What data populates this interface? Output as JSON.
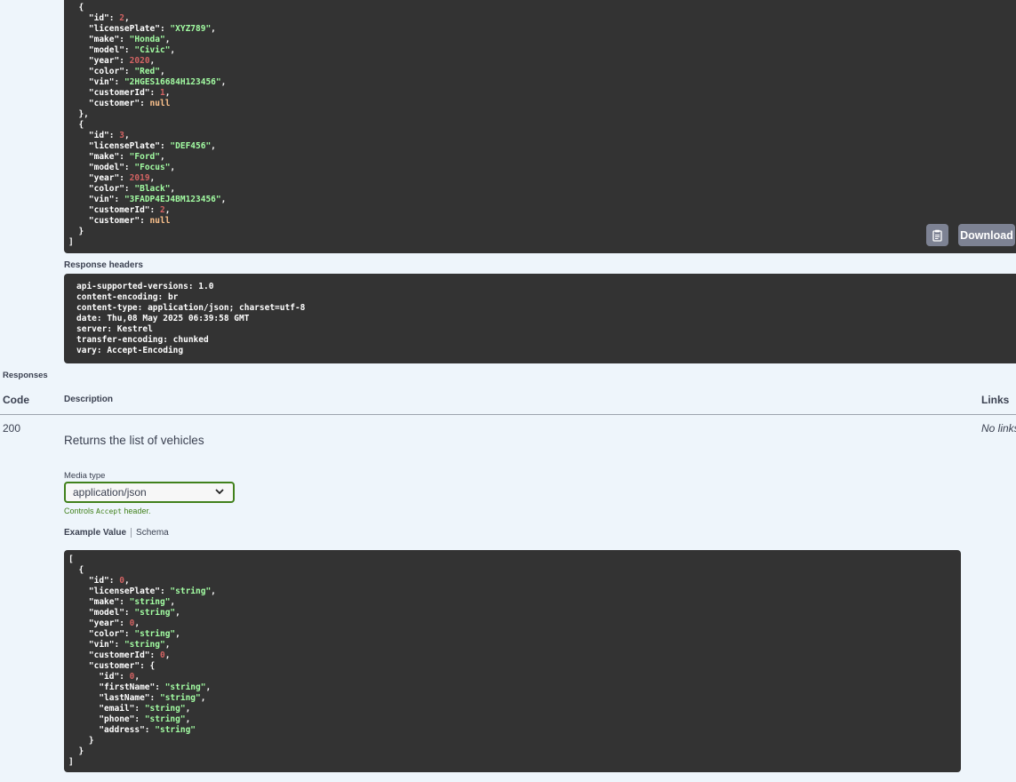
{
  "response_body": {
    "lines": [
      [
        [
          "p",
          "  {"
        ]
      ],
      [
        [
          "k",
          "    \"id\""
        ],
        [
          "p",
          ": "
        ],
        [
          "n",
          "2"
        ],
        [
          "p",
          ","
        ]
      ],
      [
        [
          "k",
          "    \"licensePlate\""
        ],
        [
          "p",
          ": "
        ],
        [
          "s",
          "\"XYZ789\""
        ],
        [
          "p",
          ","
        ]
      ],
      [
        [
          "k",
          "    \"make\""
        ],
        [
          "p",
          ": "
        ],
        [
          "s",
          "\"Honda\""
        ],
        [
          "p",
          ","
        ]
      ],
      [
        [
          "k",
          "    \"model\""
        ],
        [
          "p",
          ": "
        ],
        [
          "s",
          "\"Civic\""
        ],
        [
          "p",
          ","
        ]
      ],
      [
        [
          "k",
          "    \"year\""
        ],
        [
          "p",
          ": "
        ],
        [
          "n",
          "2020"
        ],
        [
          "p",
          ","
        ]
      ],
      [
        [
          "k",
          "    \"color\""
        ],
        [
          "p",
          ": "
        ],
        [
          "s",
          "\"Red\""
        ],
        [
          "p",
          ","
        ]
      ],
      [
        [
          "k",
          "    \"vin\""
        ],
        [
          "p",
          ": "
        ],
        [
          "s",
          "\"2HGES16684H123456\""
        ],
        [
          "p",
          ","
        ]
      ],
      [
        [
          "k",
          "    \"customerId\""
        ],
        [
          "p",
          ": "
        ],
        [
          "n",
          "1"
        ],
        [
          "p",
          ","
        ]
      ],
      [
        [
          "k",
          "    \"customer\""
        ],
        [
          "p",
          ": "
        ],
        [
          "nl",
          "null"
        ]
      ],
      [
        [
          "p",
          "  },"
        ]
      ],
      [
        [
          "p",
          "  {"
        ]
      ],
      [
        [
          "k",
          "    \"id\""
        ],
        [
          "p",
          ": "
        ],
        [
          "n",
          "3"
        ],
        [
          "p",
          ","
        ]
      ],
      [
        [
          "k",
          "    \"licensePlate\""
        ],
        [
          "p",
          ": "
        ],
        [
          "s",
          "\"DEF456\""
        ],
        [
          "p",
          ","
        ]
      ],
      [
        [
          "k",
          "    \"make\""
        ],
        [
          "p",
          ": "
        ],
        [
          "s",
          "\"Ford\""
        ],
        [
          "p",
          ","
        ]
      ],
      [
        [
          "k",
          "    \"model\""
        ],
        [
          "p",
          ": "
        ],
        [
          "s",
          "\"Focus\""
        ],
        [
          "p",
          ","
        ]
      ],
      [
        [
          "k",
          "    \"year\""
        ],
        [
          "p",
          ": "
        ],
        [
          "n",
          "2019"
        ],
        [
          "p",
          ","
        ]
      ],
      [
        [
          "k",
          "    \"color\""
        ],
        [
          "p",
          ": "
        ],
        [
          "s",
          "\"Black\""
        ],
        [
          "p",
          ","
        ]
      ],
      [
        [
          "k",
          "    \"vin\""
        ],
        [
          "p",
          ": "
        ],
        [
          "s",
          "\"3FADP4EJ4BM123456\""
        ],
        [
          "p",
          ","
        ]
      ],
      [
        [
          "k",
          "    \"customerId\""
        ],
        [
          "p",
          ": "
        ],
        [
          "n",
          "2"
        ],
        [
          "p",
          ","
        ]
      ],
      [
        [
          "k",
          "    \"customer\""
        ],
        [
          "p",
          ": "
        ],
        [
          "nl",
          "null"
        ]
      ],
      [
        [
          "p",
          "  }"
        ]
      ],
      [
        [
          "p",
          "]"
        ]
      ]
    ],
    "download_label": "Download",
    "copy_icon": "clipboard-icon"
  },
  "response_headers": {
    "title": "Response headers",
    "lines": [
      "api-supported-versions: 1.0",
      "content-encoding: br",
      "content-type: application/json; charset=utf-8",
      "date: Thu,08 May 2025 06:39:58 GMT",
      "server: Kestrel",
      "transfer-encoding: chunked",
      "vary: Accept-Encoding"
    ]
  },
  "responses": {
    "title": "Responses",
    "columns": {
      "code": "Code",
      "description": "Description",
      "links": "Links"
    },
    "row": {
      "code": "200",
      "description": "Returns the list of vehicles",
      "links": "No links"
    },
    "media_type_label": "Media type",
    "media_type_value": "application/json",
    "controls_prefix": "Controls ",
    "controls_code": "Accept",
    "controls_suffix": " header.",
    "tabs": {
      "example": "Example Value",
      "schema": "Schema"
    }
  },
  "example_body": {
    "lines": [
      [
        [
          "p",
          "["
        ]
      ],
      [
        [
          "p",
          "  {"
        ]
      ],
      [
        [
          "k",
          "    \"id\""
        ],
        [
          "p",
          ": "
        ],
        [
          "n",
          "0"
        ],
        [
          "p",
          ","
        ]
      ],
      [
        [
          "k",
          "    \"licensePlate\""
        ],
        [
          "p",
          ": "
        ],
        [
          "s",
          "\"string\""
        ],
        [
          "p",
          ","
        ]
      ],
      [
        [
          "k",
          "    \"make\""
        ],
        [
          "p",
          ": "
        ],
        [
          "s",
          "\"string\""
        ],
        [
          "p",
          ","
        ]
      ],
      [
        [
          "k",
          "    \"model\""
        ],
        [
          "p",
          ": "
        ],
        [
          "s",
          "\"string\""
        ],
        [
          "p",
          ","
        ]
      ],
      [
        [
          "k",
          "    \"year\""
        ],
        [
          "p",
          ": "
        ],
        [
          "n",
          "0"
        ],
        [
          "p",
          ","
        ]
      ],
      [
        [
          "k",
          "    \"color\""
        ],
        [
          "p",
          ": "
        ],
        [
          "s",
          "\"string\""
        ],
        [
          "p",
          ","
        ]
      ],
      [
        [
          "k",
          "    \"vin\""
        ],
        [
          "p",
          ": "
        ],
        [
          "s",
          "\"string\""
        ],
        [
          "p",
          ","
        ]
      ],
      [
        [
          "k",
          "    \"customerId\""
        ],
        [
          "p",
          ": "
        ],
        [
          "n",
          "0"
        ],
        [
          "p",
          ","
        ]
      ],
      [
        [
          "k",
          "    \"customer\""
        ],
        [
          "p",
          ": {"
        ]
      ],
      [
        [
          "k",
          "      \"id\""
        ],
        [
          "p",
          ": "
        ],
        [
          "n",
          "0"
        ],
        [
          "p",
          ","
        ]
      ],
      [
        [
          "k",
          "      \"firstName\""
        ],
        [
          "p",
          ": "
        ],
        [
          "s",
          "\"string\""
        ],
        [
          "p",
          ","
        ]
      ],
      [
        [
          "k",
          "      \"lastName\""
        ],
        [
          "p",
          ": "
        ],
        [
          "s",
          "\"string\""
        ],
        [
          "p",
          ","
        ]
      ],
      [
        [
          "k",
          "      \"email\""
        ],
        [
          "p",
          ": "
        ],
        [
          "s",
          "\"string\""
        ],
        [
          "p",
          ","
        ]
      ],
      [
        [
          "k",
          "      \"phone\""
        ],
        [
          "p",
          ": "
        ],
        [
          "s",
          "\"string\""
        ],
        [
          "p",
          ","
        ]
      ],
      [
        [
          "k",
          "      \"address\""
        ],
        [
          "p",
          ": "
        ],
        [
          "s",
          "\"string\""
        ]
      ],
      [
        [
          "p",
          "    }"
        ]
      ],
      [
        [
          "p",
          "  }"
        ]
      ],
      [
        [
          "p",
          "]"
        ]
      ]
    ]
  }
}
